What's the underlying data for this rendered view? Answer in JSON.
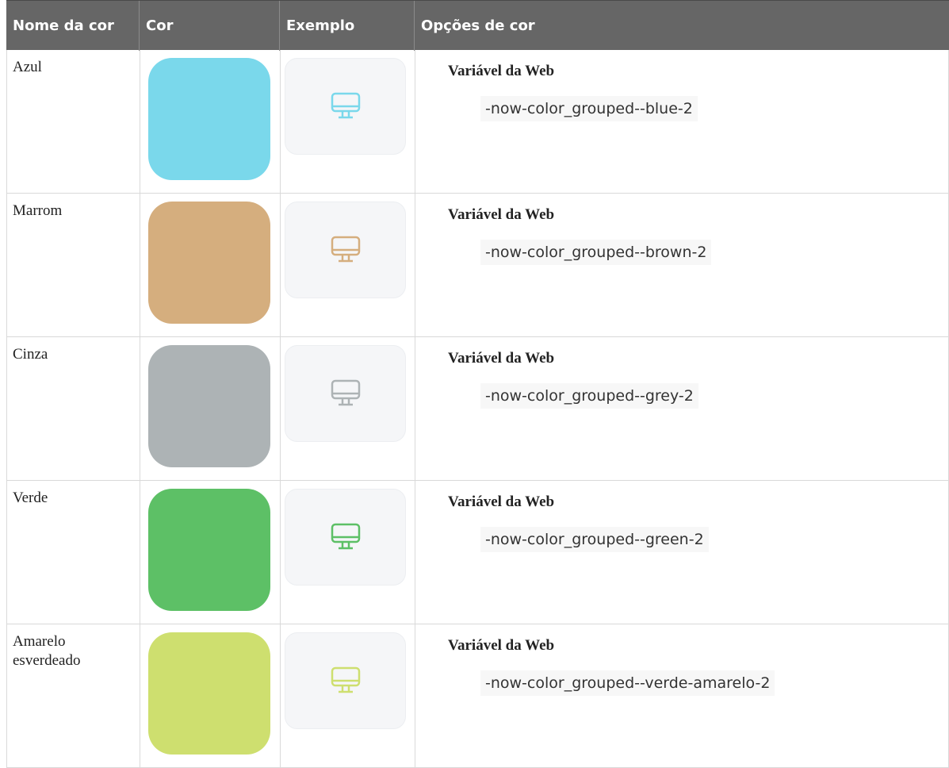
{
  "header": {
    "col_name": "Nome da cor",
    "col_color": "Cor",
    "col_example": "Exemplo",
    "col_options": "Opções de cor"
  },
  "rows": [
    {
      "name": "Azul",
      "color": "#7ad8eb",
      "icon": "monitor-icon",
      "option_label": "Variável da Web",
      "variable": "-now-color_grouped--blue-2"
    },
    {
      "name": "Marrom",
      "color": "#d5ae7e",
      "icon": "monitor-icon",
      "option_label": "Variável da Web",
      "variable": "-now-color_grouped--brown-2"
    },
    {
      "name": "Cinza",
      "color": "#adb3b5",
      "icon": "monitor-icon",
      "option_label": "Variável da Web",
      "variable": "-now-color_grouped--grey-2"
    },
    {
      "name": "Verde",
      "color": "#5dc066",
      "icon": "monitor-icon",
      "option_label": "Variável da Web",
      "variable": "-now-color_grouped--green-2"
    },
    {
      "name": "Amarelo esverdeado",
      "color": "#cedf6f",
      "icon": "monitor-icon",
      "option_label": "Variável da Web",
      "variable": "-now-color_grouped--verde-amarelo-2"
    }
  ]
}
